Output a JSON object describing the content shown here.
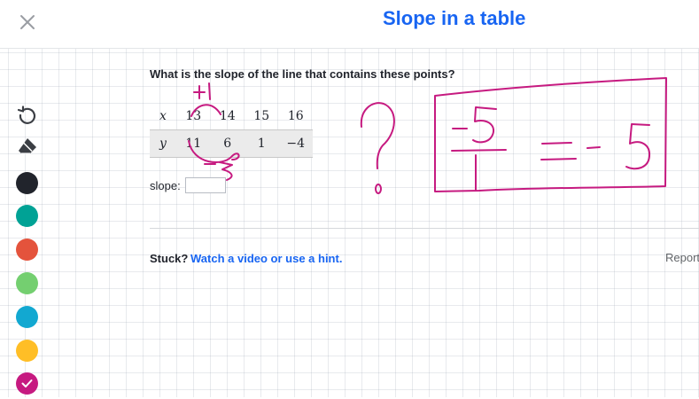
{
  "header": {
    "title": "Slope in a table",
    "title_color": "#1865f2",
    "close_icon": "close-icon"
  },
  "exercise": {
    "question": "What is the slope of the line that contains these points?",
    "table": {
      "x_label": "x",
      "y_label": "y",
      "x_values": [
        "13",
        "14",
        "15",
        "16"
      ],
      "y_values": [
        "11",
        "6",
        "1",
        "−4"
      ]
    },
    "slope_label": "slope:",
    "slope_value": "",
    "slope_placeholder": ""
  },
  "footer": {
    "stuck": "Stuck?",
    "hint_link": "Watch a video or use a hint.",
    "report": "Report"
  },
  "toolbar": {
    "tools": [
      "undo-icon",
      "eraser-icon"
    ],
    "colors": [
      {
        "name": "black",
        "hex": "#21242c"
      },
      {
        "name": "teal",
        "hex": "#00a295"
      },
      {
        "name": "red",
        "hex": "#e4533c"
      },
      {
        "name": "green",
        "hex": "#74cf70"
      },
      {
        "name": "blue",
        "hex": "#12a8d1"
      },
      {
        "name": "yellow",
        "hex": "#ffbe26"
      },
      {
        "name": "magenta",
        "hex": "#c61a80",
        "selected": true
      }
    ]
  },
  "scratchpad": {
    "ink_color": "#c61a80",
    "annotations": [
      "+1",
      "−5",
      "?",
      "−5",
      "1",
      "=",
      "−5"
    ]
  }
}
